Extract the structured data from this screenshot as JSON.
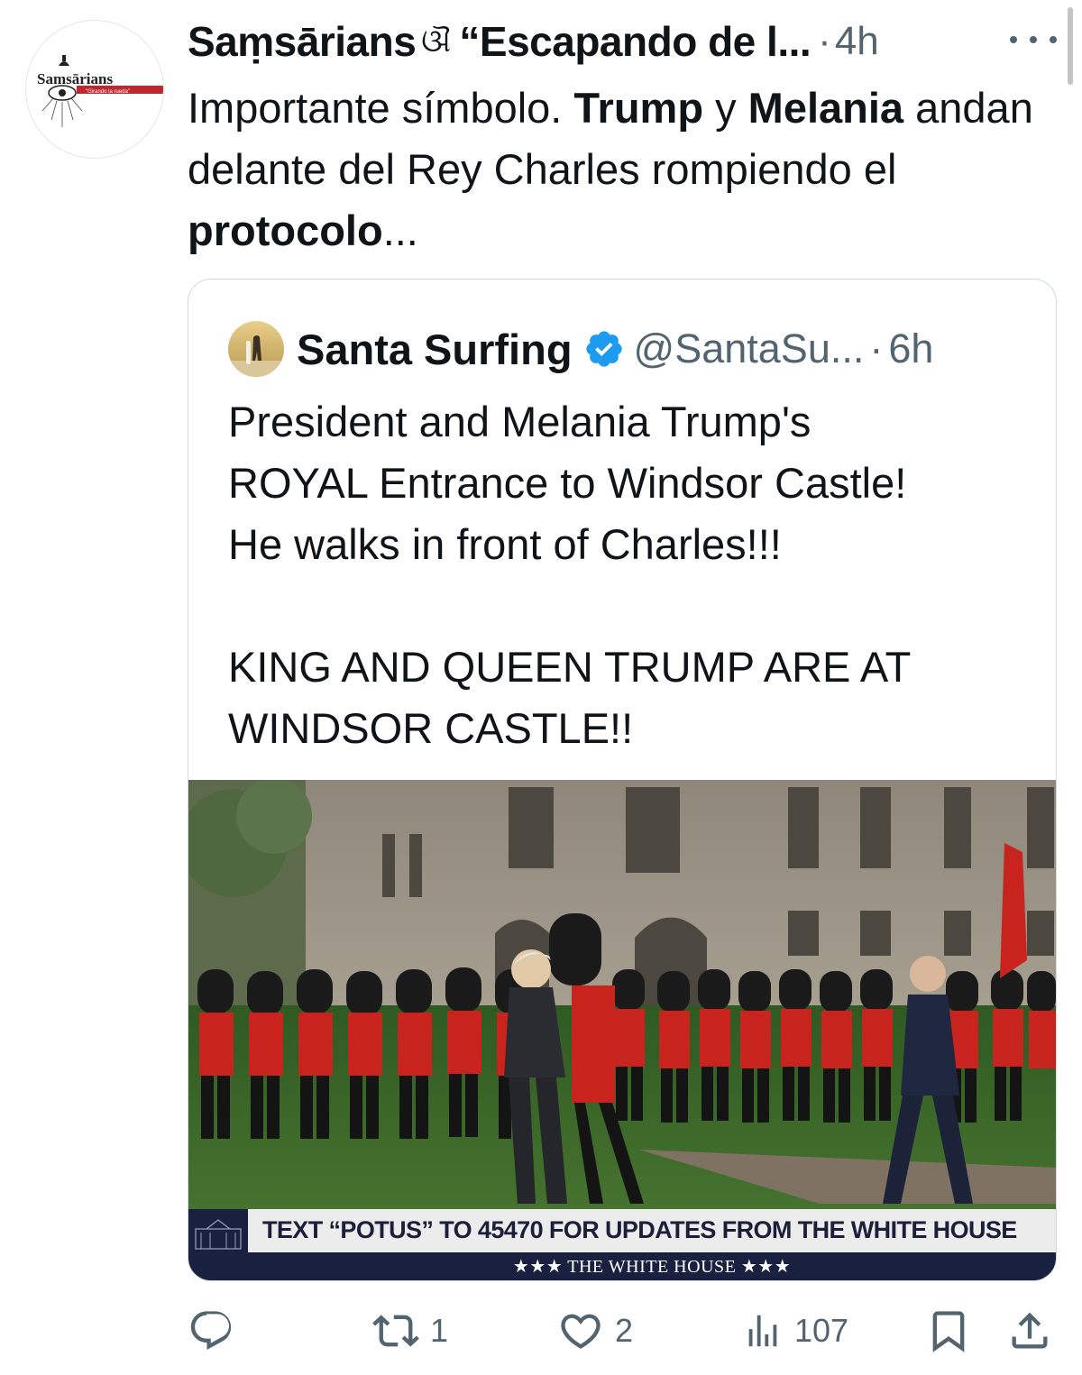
{
  "post": {
    "display_name": "Saṃsārians",
    "name_symbol": "ଔ",
    "name_tail": "“Escapando de l...",
    "separator": "·",
    "time": "4h",
    "avatar_logo_text": "Samsārians",
    "avatar_ribbon_text": "Girando la rueda",
    "text_parts": {
      "p1": "Importante símbolo. ",
      "b1": "Trump",
      "p2": " y ",
      "b2": "Melania",
      "p3": " andan delante del Rey Charles rompiendo el ",
      "b3": "protocolo",
      "p4": "..."
    }
  },
  "quoted": {
    "display_name": "Santa Surfing",
    "handle": "@SantaSu...",
    "separator": "·",
    "time": "6h",
    "text": "President and Melania Trump's\nROYAL Entrance to Windsor Castle!\nHe walks in front of Charles!!!\n\nKING AND QUEEN TRUMP ARE AT\nWINDSOR CASTLE!!",
    "media": {
      "ticker_text": "TEXT “POTUS” TO 45470 FOR UPDATES FROM THE WHITE HOUSE",
      "ticker_bar_text": "★★★  THE WHITE HOUSE  ★★★"
    }
  },
  "actions": {
    "replies": {
      "icon": "reply-icon",
      "count": ""
    },
    "reposts": {
      "icon": "repost-icon",
      "count": "1"
    },
    "likes": {
      "icon": "heart-icon",
      "count": "2"
    },
    "views": {
      "icon": "views-icon",
      "count": "107"
    },
    "bookmark": {
      "icon": "bookmark-icon"
    },
    "share": {
      "icon": "share-icon"
    }
  },
  "colors": {
    "text": "#0f1419",
    "muted": "#536471",
    "border": "#cfd9de",
    "verified": "#1d9bf0",
    "guard_red": "#c8231d",
    "grass": "#3e6b2a"
  }
}
